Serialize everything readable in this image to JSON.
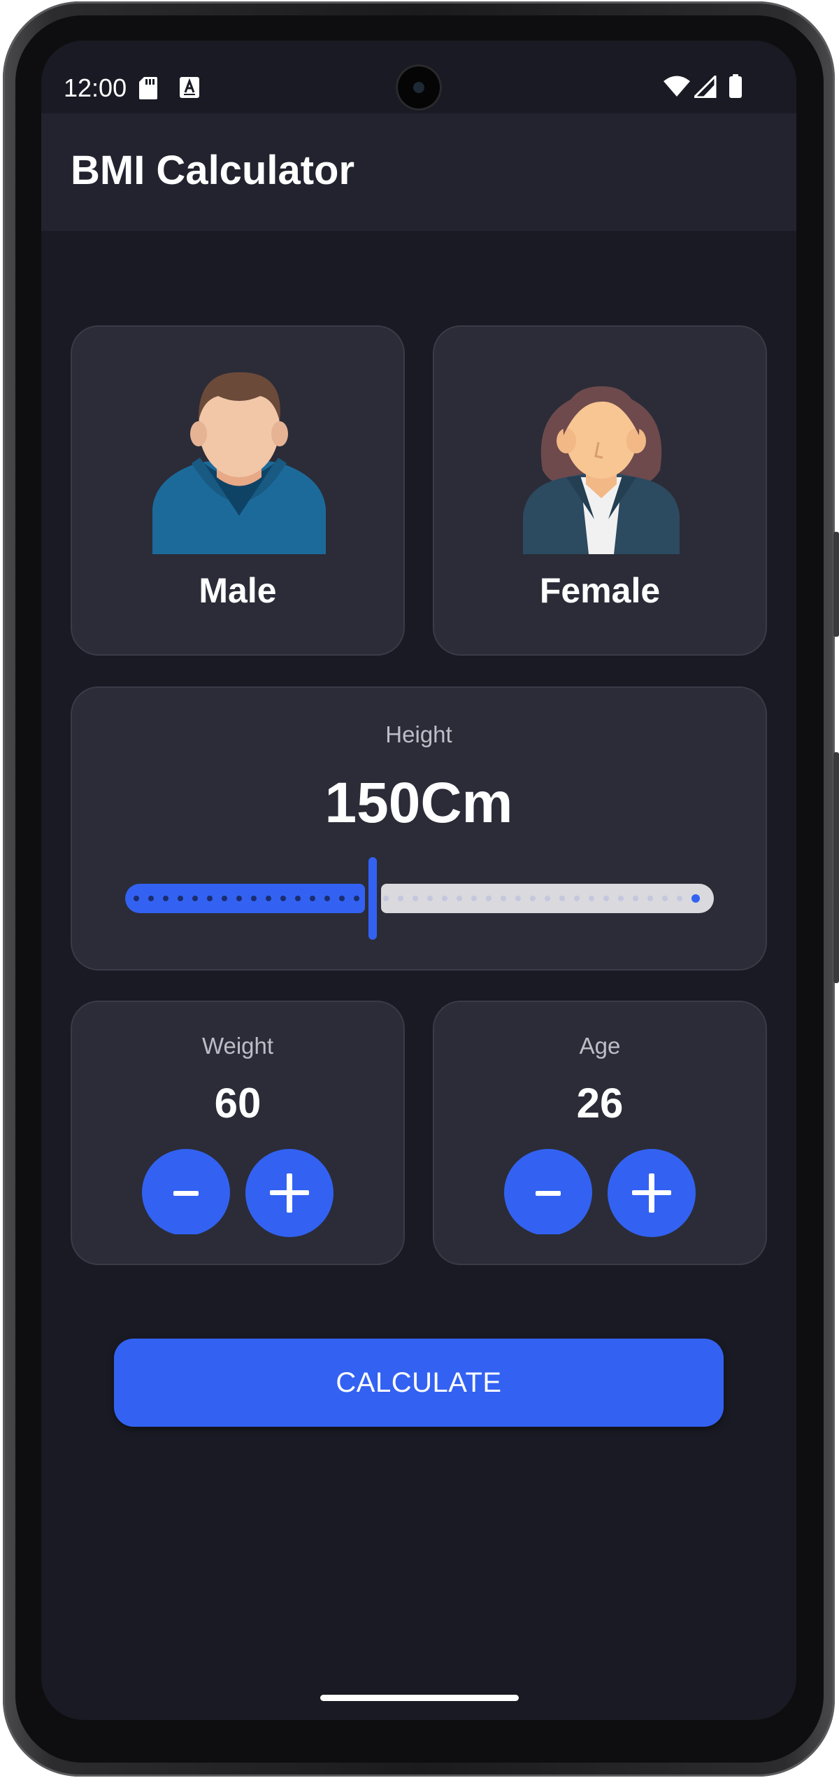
{
  "status_bar": {
    "time": "12:00",
    "icons": [
      "sd-card-icon",
      "keyboard-a-icon",
      "wifi-icon",
      "cellular-signal-icon",
      "battery-icon"
    ]
  },
  "app_bar": {
    "title": "BMI Calculator"
  },
  "gender": {
    "male_label": "Male",
    "female_label": "Female",
    "male_icon": "male-avatar-icon",
    "female_icon": "female-avatar-icon"
  },
  "height": {
    "caption": "Height",
    "value_text": "150Cm",
    "slider_fraction": 0.42
  },
  "weight": {
    "caption": "Weight",
    "value": "60"
  },
  "age": {
    "caption": "Age",
    "value": "26"
  },
  "actions": {
    "calculate_label": "CALCULATE"
  },
  "colors": {
    "accent": "#3362f2",
    "background": "#191a23",
    "card": "#2b2c37",
    "app_bar": "#22232f"
  }
}
